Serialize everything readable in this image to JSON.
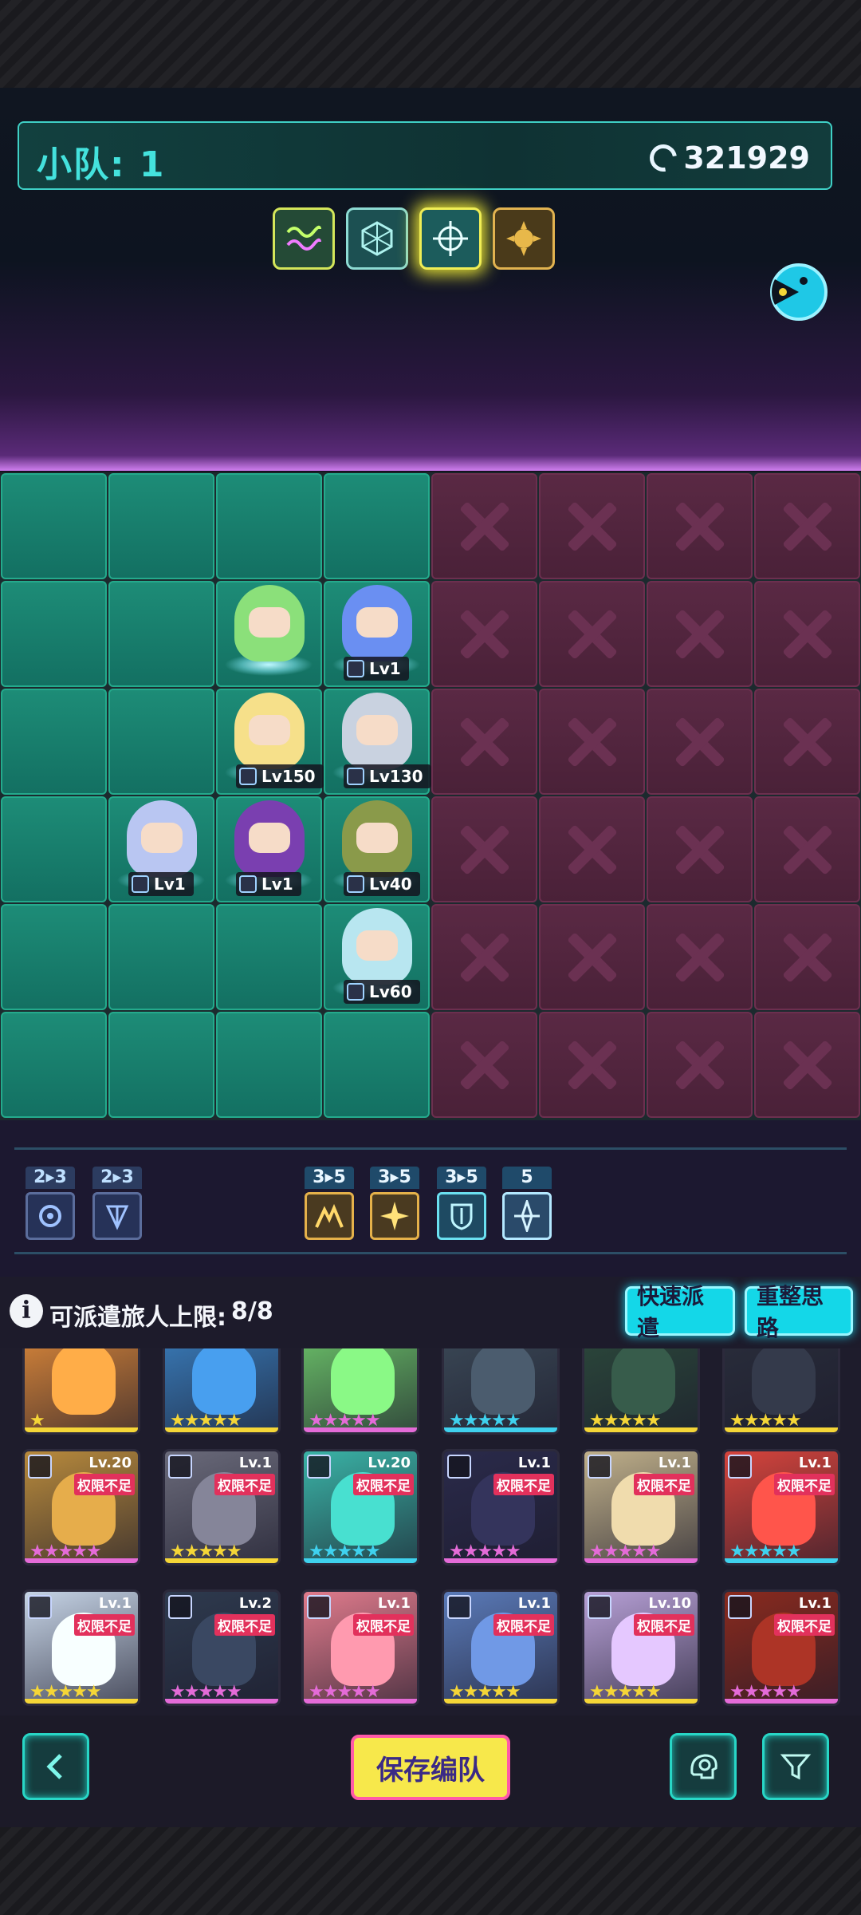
{
  "squad": {
    "title": "小队: 1",
    "power": "321929"
  },
  "formations": [
    "wave-icon",
    "web-icon",
    "crosshair-icon",
    "gear-icon"
  ],
  "board": {
    "columns": 8,
    "rows": 6,
    "player_columns": 4,
    "units": [
      {
        "name": "unit-green-haired",
        "col": 3,
        "row": 2,
        "level": ""
      },
      {
        "name": "unit-hooded-blue",
        "col": 4,
        "row": 2,
        "level": "Lv1"
      },
      {
        "name": "unit-blonde-girl",
        "col": 3,
        "row": 3,
        "level": "Lv150"
      },
      {
        "name": "unit-goggles-boy",
        "col": 4,
        "row": 3,
        "level": "Lv130"
      },
      {
        "name": "unit-fox-girl",
        "col": 2,
        "row": 4,
        "level": "Lv1"
      },
      {
        "name": "unit-purple-cat",
        "col": 3,
        "row": 4,
        "level": "Lv1"
      },
      {
        "name": "unit-soldier",
        "col": 4,
        "row": 4,
        "level": "Lv40"
      },
      {
        "name": "unit-ghost",
        "col": 4,
        "row": 5,
        "level": "Lv60"
      }
    ]
  },
  "traits": [
    {
      "count": "2▸3",
      "icon": "swirl-icon",
      "style": "inactive"
    },
    {
      "count": "2▸3",
      "icon": "shard-icon",
      "style": "inactive"
    },
    {
      "count": "3▸5",
      "icon": "mountain-icon",
      "style": "gold"
    },
    {
      "count": "3▸5",
      "icon": "star-burst-icon",
      "style": "gold"
    },
    {
      "count": "3▸5",
      "icon": "shield-icon",
      "style": "cyan"
    },
    {
      "count": "5",
      "icon": "compass-icon",
      "style": "white"
    }
  ],
  "deploy": {
    "label": "可派遣旅人上限:",
    "count": "8/8",
    "quick_button": "快速派遣",
    "rethink_button": "重整思路"
  },
  "roster": [
    {
      "level": "",
      "limit": "",
      "stars": "★",
      "star_color": "#f5d637",
      "bg": "#e08a3a"
    },
    {
      "level": "",
      "limit": "",
      "stars": "★★★★★",
      "star_color": "#f5d637",
      "bg": "#3a7fbf"
    },
    {
      "level": "",
      "limit": "",
      "stars": "★★★★★",
      "star_color": "#e46bd8",
      "bg": "#6ec76b"
    },
    {
      "level": "",
      "limit": "",
      "stars": "★★★★★",
      "star_color": "#3fd1ee",
      "bg": "#3c4a58"
    },
    {
      "level": "",
      "limit": "",
      "stars": "★★★★★",
      "star_color": "#f5d637",
      "bg": "#2c4a3c"
    },
    {
      "level": "",
      "limit": "",
      "stars": "★★★★★",
      "star_color": "#f5d637",
      "bg": "#2a2e3c"
    },
    {
      "level": "Lv.20",
      "limit": "权限不足",
      "stars": "★★★★★",
      "star_color": "#e46bd8",
      "bg": "#b88a3c"
    },
    {
      "level": "Lv.1",
      "limit": "权限不足",
      "stars": "★★★★★",
      "star_color": "#f5d637",
      "bg": "#6a6a7a"
    },
    {
      "level": "Lv.20",
      "limit": "权限不足",
      "stars": "★★★★★",
      "star_color": "#3fd1ee",
      "bg": "#3ab3a6"
    },
    {
      "level": "Lv.1",
      "limit": "权限不足",
      "stars": "★★★★★",
      "star_color": "#e46bd8",
      "bg": "#2a2a4a"
    },
    {
      "level": "Lv.1",
      "limit": "权限不足",
      "stars": "★★★★★",
      "star_color": "#e46bd8",
      "bg": "#c0b08a"
    },
    {
      "level": "Lv.1",
      "limit": "权限不足",
      "stars": "★★★★★",
      "star_color": "#3fd1ee",
      "bg": "#d6443c"
    },
    {
      "level": "Lv.1",
      "limit": "权限不足",
      "stars": "★★★★★",
      "star_color": "#f5d637",
      "bg": "#c6d4e6"
    },
    {
      "level": "Lv.2",
      "limit": "权限不足",
      "stars": "★★★★★",
      "star_color": "#e46bd8",
      "bg": "#2e3a4e"
    },
    {
      "level": "Lv.1",
      "limit": "权限不足",
      "stars": "★★★★★",
      "star_color": "#e46bd8",
      "bg": "#e07b8c"
    },
    {
      "level": "Lv.1",
      "limit": "权限不足",
      "stars": "★★★★★",
      "star_color": "#f5d637",
      "bg": "#5a7ab8"
    },
    {
      "level": "Lv.10",
      "limit": "权限不足",
      "stars": "★★★★★",
      "star_color": "#f5d637",
      "bg": "#b7a0d6"
    },
    {
      "level": "Lv.1",
      "limit": "权限不足",
      "stars": "★★★★★",
      "star_color": "#e46bd8",
      "bg": "#8a2a1e"
    }
  ],
  "bottom": {
    "back_icon": "chevron-left-icon",
    "save_button": "保存编队",
    "brain_icon": "brain-icon",
    "filter_icon": "filter-icon"
  },
  "colors": {
    "accent_cyan": "#3fd0c6",
    "player_tile": "#1d8c77",
    "locked_tile": "#5a2944",
    "save_button": "#f7e84b",
    "limit_badge": "#e2315c"
  }
}
